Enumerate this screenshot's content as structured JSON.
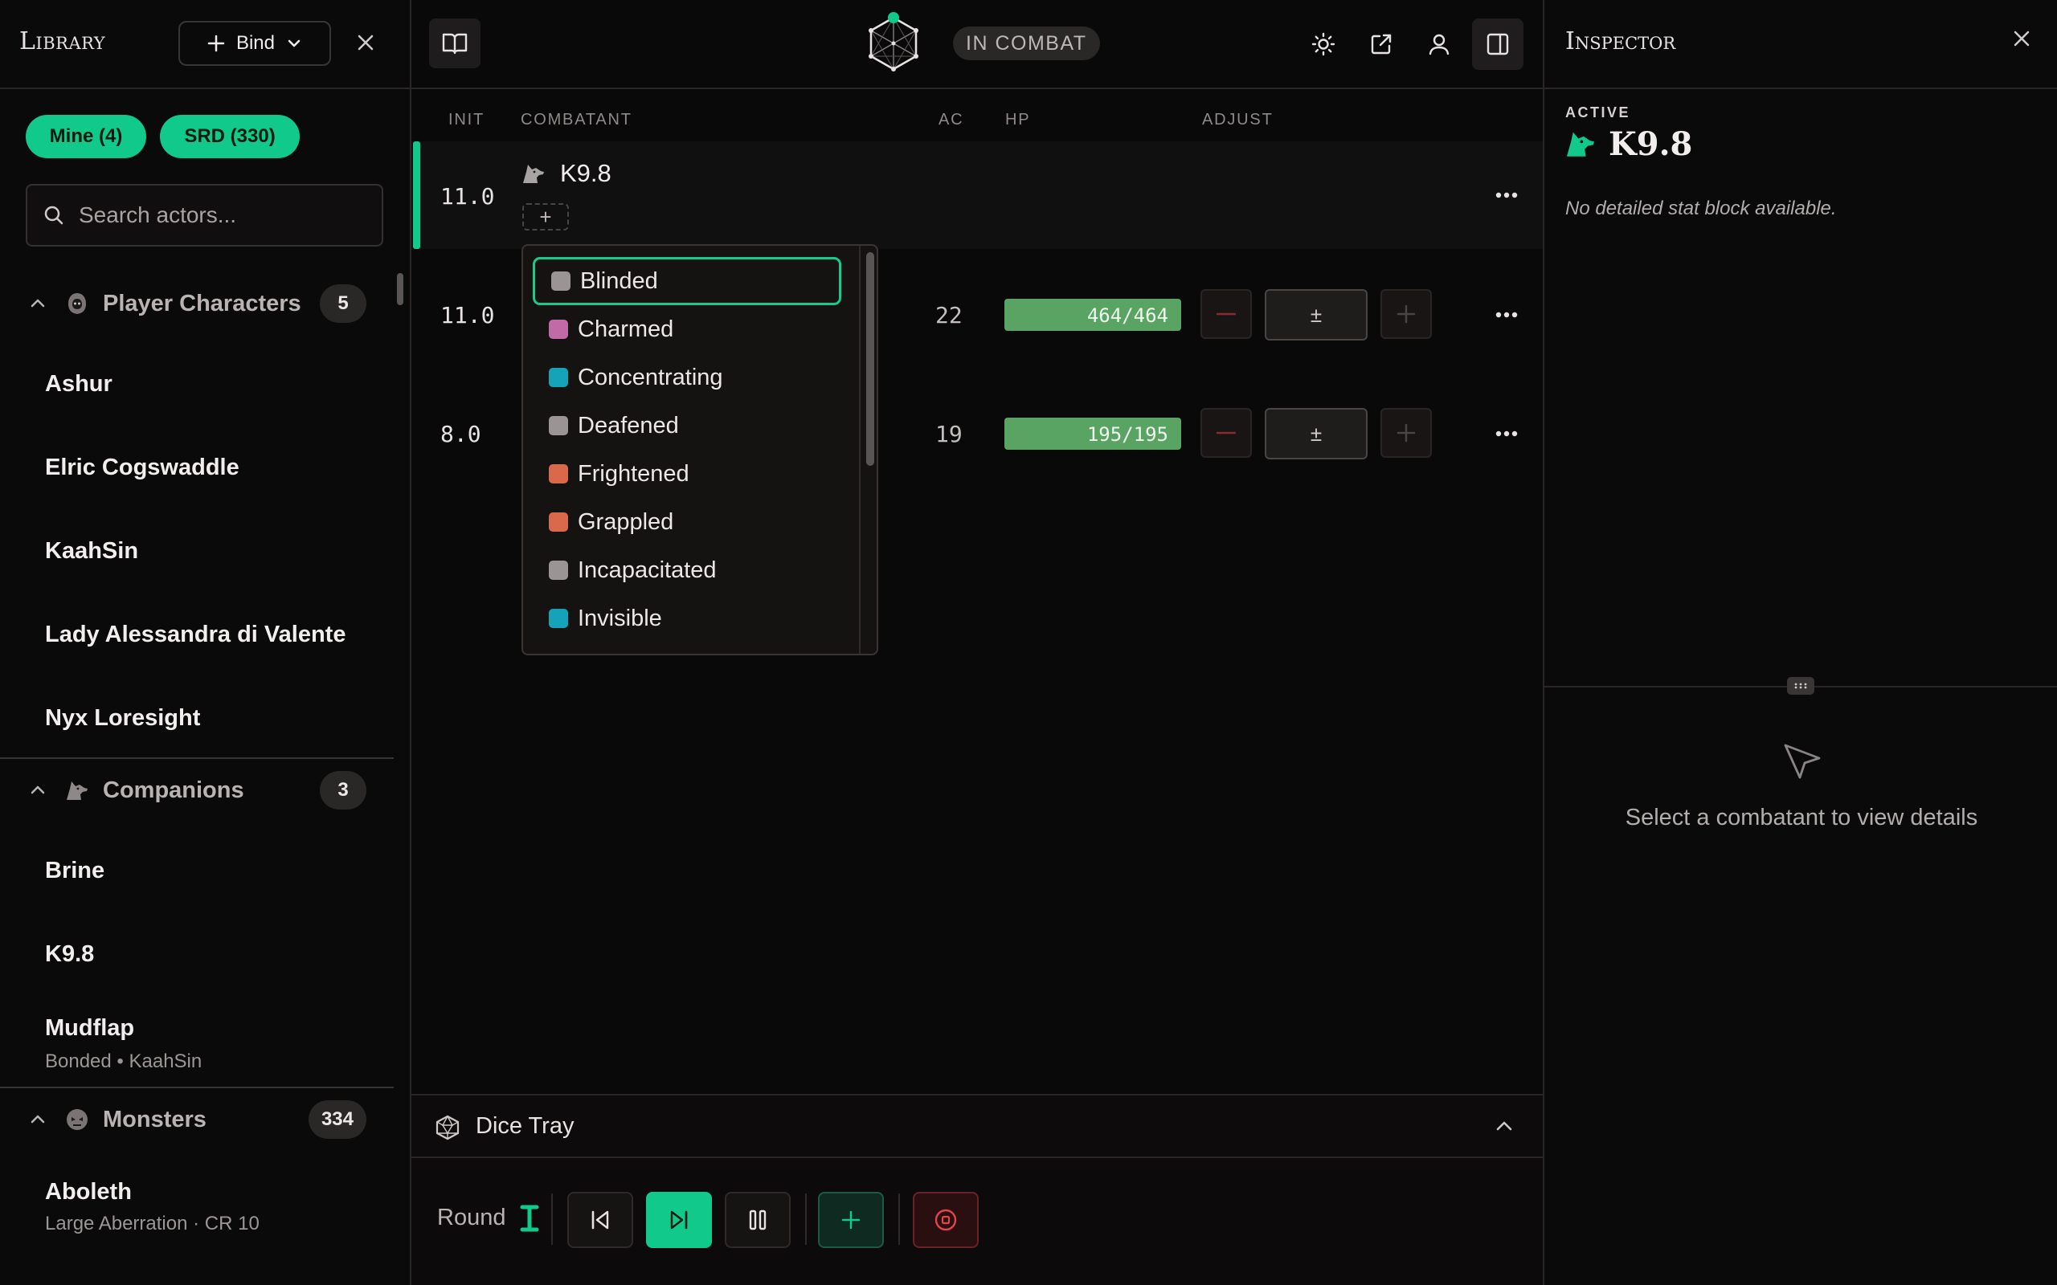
{
  "library": {
    "title": "Library",
    "bind_label": "Bind",
    "filters": {
      "mine": "Mine (4)",
      "srd": "SRD (330)"
    },
    "search_placeholder": "Search actors...",
    "sections": {
      "player_characters": {
        "label": "Player Characters",
        "count": "5",
        "items": [
          "Ashur",
          "Elric Cogswaddle",
          "KaahSin",
          "Lady Alessandra di Valente",
          "Nyx Loresight"
        ]
      },
      "companions": {
        "label": "Companions",
        "count": "3",
        "items": [
          "Brine",
          "K9.8"
        ],
        "mudflap": {
          "name": "Mudflap",
          "sub": "Bonded • KaahSin"
        }
      },
      "monsters": {
        "label": "Monsters",
        "count": "334",
        "aboleth": {
          "name": "Aboleth",
          "sub": "Large Aberration · CR 10"
        }
      }
    }
  },
  "topbar": {
    "status": "IN COMBAT"
  },
  "tracker": {
    "columns": {
      "init": "INIT",
      "combatant": "COMBATANT",
      "ac": "AC",
      "hp": "HP",
      "adjust": "ADJUST"
    },
    "rows": [
      {
        "init": "11.0",
        "name": "K9.8",
        "add_condition": "+"
      },
      {
        "init": "11.0",
        "ac": "22",
        "hp": "464/464",
        "hp_fraction": 1.0,
        "adjust": "±"
      },
      {
        "init": "8.0",
        "ac": "19",
        "hp": "195/195",
        "hp_fraction": 1.0,
        "adjust": "±"
      }
    ],
    "conditions": [
      {
        "label": "Blinded",
        "color": "#9a9494"
      },
      {
        "label": "Charmed",
        "color": "#c06aa8"
      },
      {
        "label": "Concentrating",
        "color": "#14a3b8"
      },
      {
        "label": "Deafened",
        "color": "#9a9494"
      },
      {
        "label": "Frightened",
        "color": "#d9694a"
      },
      {
        "label": "Grappled",
        "color": "#d9694a"
      },
      {
        "label": "Incapacitated",
        "color": "#9a9494"
      },
      {
        "label": "Invisible",
        "color": "#14a3b8"
      }
    ]
  },
  "dice_tray": {
    "label": "Dice Tray"
  },
  "round": {
    "label": "Round"
  },
  "inspector": {
    "title": "Inspector",
    "active_label": "ACTIVE",
    "active_name": "K9.8",
    "note": "No detailed stat block available.",
    "empty": "Select a combatant to view details"
  },
  "colors": {
    "accent": "#10c98a",
    "hp_bar": "#5aa463",
    "danger": "#e2454c"
  }
}
